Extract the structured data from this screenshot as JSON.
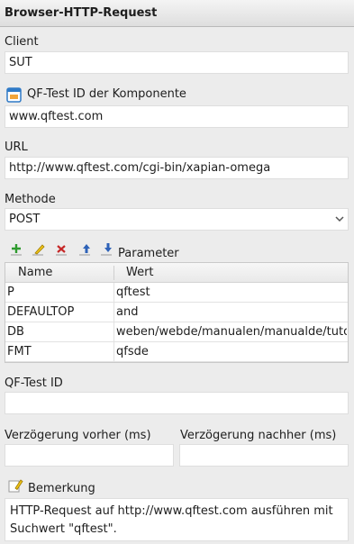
{
  "header": {
    "title": "Browser-HTTP-Request"
  },
  "client": {
    "label": "Client",
    "value": "SUT"
  },
  "component": {
    "label": "QF-Test ID der Komponente",
    "value": "www.qftest.com",
    "icon": "component-window-icon"
  },
  "url": {
    "label": "URL",
    "value": "http://www.qftest.com/cgi-bin/xapian-omega"
  },
  "method": {
    "label": "Methode",
    "value": "POST"
  },
  "parameters": {
    "label": "Parameter",
    "toolbar": {
      "add_icon": "plus-icon",
      "edit_icon": "pencil-icon",
      "delete_icon": "x-icon",
      "up_icon": "arrow-up-icon",
      "down_icon": "arrow-down-icon"
    },
    "columns": [
      "Name",
      "Wert"
    ],
    "rows": [
      {
        "name": "P",
        "value": "qftest"
      },
      {
        "name": "DEFAULTOP",
        "value": "and"
      },
      {
        "name": "DB",
        "value": "weben/webde/manualen/manualde/tutori"
      },
      {
        "name": "FMT",
        "value": "qfsde"
      }
    ]
  },
  "qftest_id": {
    "label": "QF-Test ID",
    "value": ""
  },
  "delay_before": {
    "label": "Verzögerung vorher (ms)",
    "value": ""
  },
  "delay_after": {
    "label": "Verzögerung nachher (ms)",
    "value": ""
  },
  "comment": {
    "label": "Bemerkung",
    "icon": "pencil-icon",
    "text": "HTTP-Request auf http://www.qftest.com ausführen mit Suchwert \"qftest\"."
  },
  "colors": {
    "add": "#2e9b2e",
    "delete": "#c62828",
    "arrows": "#2e62b8",
    "pencil": "#f0c419"
  }
}
